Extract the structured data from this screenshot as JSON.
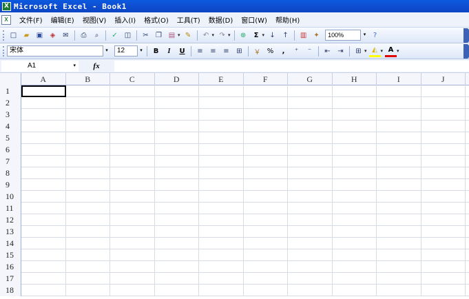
{
  "window": {
    "title": "Microsoft Excel - Book1"
  },
  "menu": {
    "items": [
      "文件(F)",
      "编辑(E)",
      "视图(V)",
      "插入(I)",
      "格式(O)",
      "工具(T)",
      "数据(D)",
      "窗口(W)",
      "帮助(H)"
    ]
  },
  "standard_toolbar": {
    "zoom": "100%",
    "autosum": "Σ"
  },
  "formatting_toolbar": {
    "font_name": "宋体",
    "font_size": "12",
    "bold": "B",
    "italic": "I",
    "underline": "U",
    "percent": "%",
    "comma": ","
  },
  "formula_bar": {
    "name_box": "A1",
    "fx": "fx",
    "formula": ""
  },
  "sheet": {
    "columns": [
      "A",
      "B",
      "C",
      "D",
      "E",
      "F",
      "G",
      "H",
      "I",
      "J"
    ],
    "rows": [
      "1",
      "2",
      "3",
      "4",
      "5",
      "6",
      "7",
      "8",
      "9",
      "10",
      "11",
      "12",
      "13",
      "14",
      "15",
      "16",
      "17",
      "18"
    ],
    "active_cell": "A1"
  }
}
